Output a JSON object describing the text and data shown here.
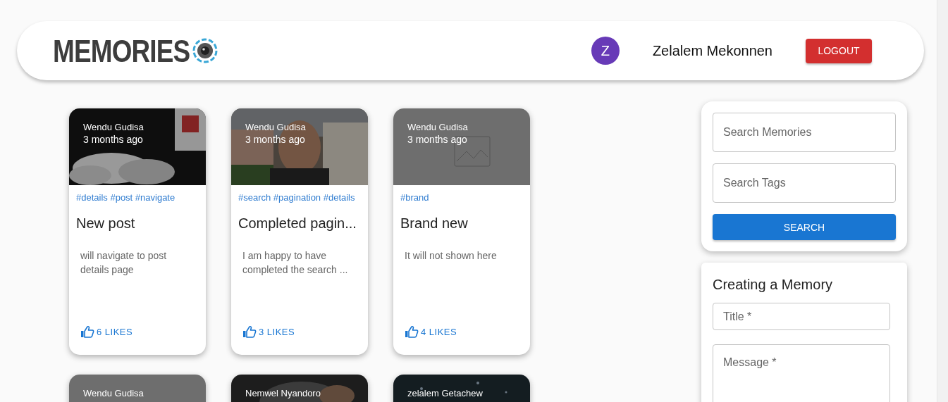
{
  "header": {
    "logo": "MEMORIES",
    "user": {
      "initial": "Z",
      "name": "Zelalem Mekonnen"
    },
    "logout": "LOGOUT"
  },
  "posts": [
    {
      "kind": "picture",
      "author": "Wendu Gudisa",
      "time": "3 months ago",
      "tags": "#details #post #navigate",
      "title": "New post",
      "message": "will navigate to post details page",
      "likes": "6 LIKES"
    },
    {
      "kind": "picture",
      "author": "Wendu Gudisa",
      "time": "3 months ago",
      "tags": "#search #pagination #details",
      "title": "Completed pagin...",
      "message": "I am happy to have completed the search ...",
      "likes": "3 LIKES"
    },
    {
      "kind": "no-image",
      "author": "Wendu Gudisa",
      "time": "3 months ago",
      "tags": "#brand",
      "title": "Brand new",
      "message": "It will not shown here",
      "likes": "4 LIKES"
    },
    {
      "kind": "no-image",
      "author": "Wendu Gudisa"
    },
    {
      "kind": "picture",
      "author": "Nemwel Nyandoro"
    },
    {
      "kind": "picture",
      "author": "zelalem Getachew"
    }
  ],
  "search": {
    "memories_placeholder": "Search Memories",
    "tags_placeholder": "Search Tags",
    "button": "SEARCH"
  },
  "form": {
    "heading": "Creating a Memory",
    "title_placeholder": "Title *",
    "message_placeholder": "Message *"
  }
}
